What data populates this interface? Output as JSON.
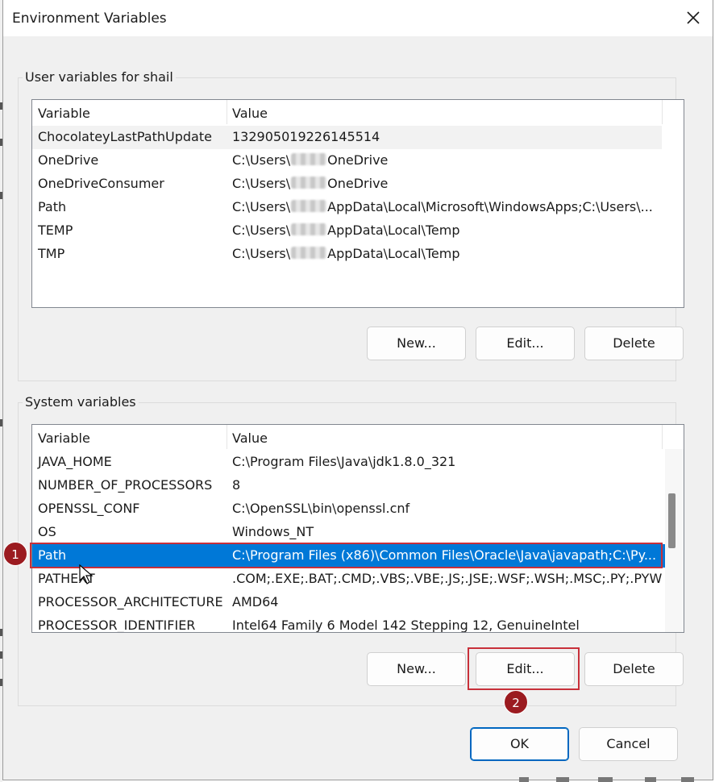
{
  "dialog": {
    "title": "Environment Variables",
    "close_icon": "close-icon"
  },
  "user_vars": {
    "group_label": "User variables for shail",
    "columns": [
      "Variable",
      "Value"
    ],
    "rows": [
      {
        "name": "ChocolateyLastPathUpdate",
        "value_pre": "132905019226145514",
        "redacted": false,
        "value_post": ""
      },
      {
        "name": "OneDrive",
        "value_pre": "C:\\Users\\",
        "redacted": true,
        "value_post": "OneDrive"
      },
      {
        "name": "OneDriveConsumer",
        "value_pre": "C:\\Users\\",
        "redacted": true,
        "value_post": "OneDrive"
      },
      {
        "name": "Path",
        "value_pre": "C:\\Users\\",
        "redacted": true,
        "value_post": "AppData\\Local\\Microsoft\\WindowsApps;C:\\Users\\..."
      },
      {
        "name": "TEMP",
        "value_pre": "C:\\Users\\",
        "redacted": true,
        "value_post": "AppData\\Local\\Temp"
      },
      {
        "name": "TMP",
        "value_pre": "C:\\Users\\",
        "redacted": true,
        "value_post": "AppData\\Local\\Temp"
      }
    ],
    "buttons": {
      "new": "New...",
      "edit": "Edit...",
      "delete": "Delete"
    }
  },
  "system_vars": {
    "group_label": "System variables",
    "columns": [
      "Variable",
      "Value"
    ],
    "rows": [
      {
        "name": "JAVA_HOME",
        "value": "C:\\Program Files\\Java\\jdk1.8.0_321"
      },
      {
        "name": "NUMBER_OF_PROCESSORS",
        "value": "8"
      },
      {
        "name": "OPENSSL_CONF",
        "value": "C:\\OpenSSL\\bin\\openssl.cnf"
      },
      {
        "name": "OS",
        "value": "Windows_NT"
      },
      {
        "name": "Path",
        "value": "C:\\Program Files (x86)\\Common Files\\Oracle\\Java\\javapath;C:\\Py..."
      },
      {
        "name": "PATHEXT",
        "value": ".COM;.EXE;.BAT;.CMD;.VBS;.VBE;.JS;.JSE;.WSF;.WSH;.MSC;.PY;.PYW"
      },
      {
        "name": "PROCESSOR_ARCHITECTURE",
        "value": "AMD64"
      },
      {
        "name": "PROCESSOR_IDENTIFIER",
        "value": "Intel64 Family 6 Model 142 Stepping 12, GenuineIntel"
      }
    ],
    "selected_row": "Path",
    "buttons": {
      "new": "New...",
      "edit": "Edit...",
      "delete": "Delete"
    }
  },
  "footer": {
    "ok": "OK",
    "cancel": "Cancel"
  },
  "annotations": {
    "marker_1": "1",
    "marker_2": "2"
  },
  "colors": {
    "selection": "#0078d7",
    "highlight_box": "#c8303a",
    "marker_fill": "#9b1b20",
    "primary_border": "#0067c0"
  }
}
